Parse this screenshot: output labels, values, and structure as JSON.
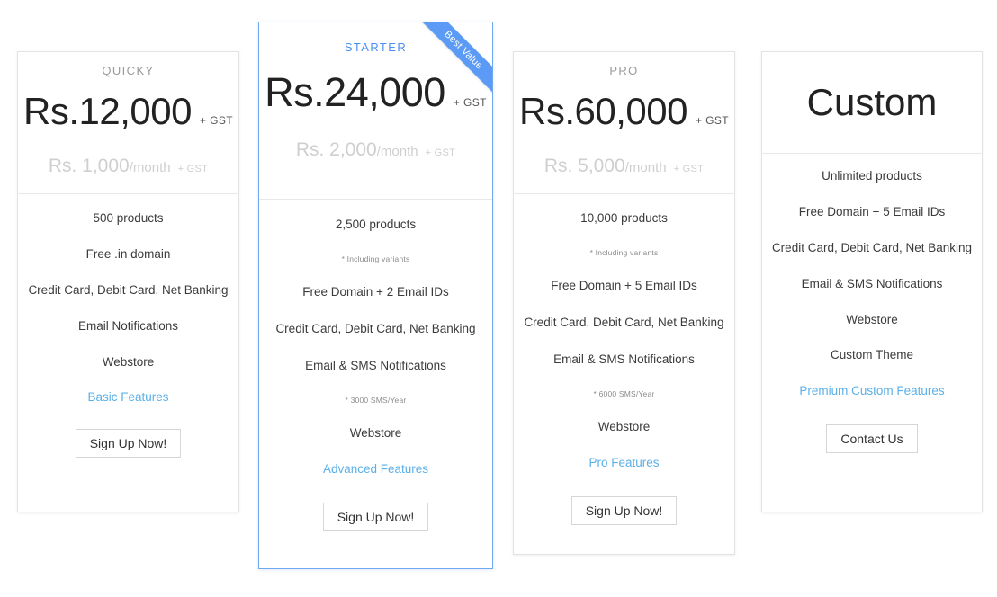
{
  "plans": [
    {
      "id": "quicky",
      "name": "QUICKY",
      "price": "Rs.12,000",
      "price_gst": "+ GST",
      "monthly_amount": "Rs. 1,000",
      "monthly_period": "/month",
      "monthly_gst": "+ GST",
      "features": [
        {
          "text": "500 products"
        },
        {
          "text": "Free .in domain"
        },
        {
          "text": "Credit Card, Debit Card, Net Banking"
        },
        {
          "text": "Email Notifications"
        },
        {
          "text": "Webstore"
        }
      ],
      "link_label": "Basic Features",
      "cta_label": "Sign Up Now!"
    },
    {
      "id": "starter",
      "name": "STARTER",
      "badge": "Best Value",
      "price": "Rs.24,000",
      "price_gst": "+ GST",
      "monthly_amount": "Rs. 2,000",
      "monthly_period": "/month",
      "monthly_gst": "+ GST",
      "features": [
        {
          "text": "2,500 products",
          "note": "* Including variants"
        },
        {
          "text": "Free Domain + 2 Email IDs"
        },
        {
          "text": "Credit Card, Debit Card, Net Banking"
        },
        {
          "text": "Email & SMS Notifications",
          "note": "* 3000 SMS/Year"
        },
        {
          "text": "Webstore"
        }
      ],
      "link_label": "Advanced Features",
      "cta_label": "Sign Up Now!"
    },
    {
      "id": "pro",
      "name": "PRO",
      "price": "Rs.60,000",
      "price_gst": "+ GST",
      "monthly_amount": "Rs. 5,000",
      "monthly_period": "/month",
      "monthly_gst": "+ GST",
      "features": [
        {
          "text": "10,000 products",
          "note": "* Including variants"
        },
        {
          "text": "Free Domain + 5 Email IDs"
        },
        {
          "text": "Credit Card, Debit Card, Net Banking"
        },
        {
          "text": "Email & SMS Notifications",
          "note": "* 6000 SMS/Year"
        },
        {
          "text": "Webstore"
        }
      ],
      "link_label": "Pro Features",
      "cta_label": "Sign Up Now!"
    },
    {
      "id": "custom",
      "name": "",
      "price": "Custom",
      "features": [
        {
          "text": "Unlimited products"
        },
        {
          "text": "Free Domain + 5 Email IDs"
        },
        {
          "text": "Credit Card, Debit Card, Net Banking"
        },
        {
          "text": "Email & SMS Notifications"
        },
        {
          "text": "Webstore"
        },
        {
          "text": "Custom Theme"
        }
      ],
      "link_label": "Premium Custom Features",
      "cta_label": "Contact Us"
    }
  ],
  "colors": {
    "accent_blue": "#4a90f0",
    "ribbon_blue": "#5b9bf5",
    "link_blue": "#5bb0e8",
    "price_text": "#222222",
    "muted_gray": "#cfcfcf",
    "card_border": "#e3e3e3",
    "featured_border": "#6ea8f0"
  }
}
